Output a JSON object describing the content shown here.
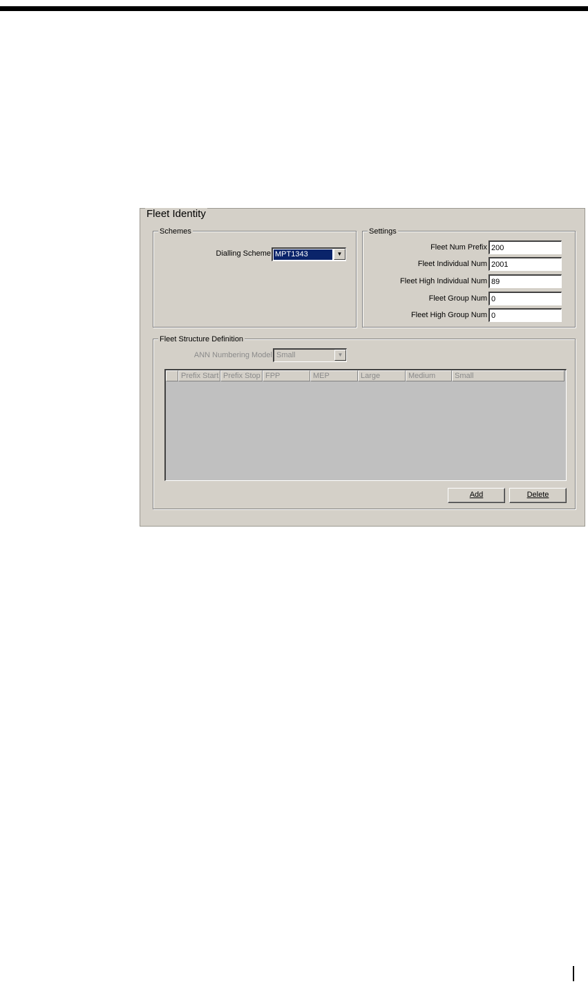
{
  "panel": {
    "title": "Fleet Identity"
  },
  "schemes": {
    "group_label": "Schemes",
    "dialling_scheme_label": "Dialling Scheme",
    "dialling_scheme_value": "MPT1343"
  },
  "settings": {
    "group_label": "Settings",
    "fields": [
      {
        "label": "Fleet Num Prefix",
        "value": "200"
      },
      {
        "label": "Fleet Individual Num",
        "value": "2001"
      },
      {
        "label": "Fleet High Individual Num",
        "value": "89"
      },
      {
        "label": "Fleet Group Num",
        "value": "0"
      },
      {
        "label": "Fleet High Group Num",
        "value": "0"
      }
    ]
  },
  "structure": {
    "group_label": "Fleet Structure Definition",
    "ann_model_label": "ANN Numbering Model",
    "ann_model_value": "Small",
    "columns": [
      "",
      "Prefix Start",
      "Prefix Stop",
      "FPP",
      "MEP",
      "Large",
      "Medium",
      "Small"
    ],
    "add_label": "Add",
    "delete_label": "Delete"
  },
  "icons": {
    "dropdown": "chevron-down-icon"
  },
  "colors": {
    "dialog_bg": "#d4d0c8",
    "selection": "#0a246a",
    "grid_bg": "#c0c0c0"
  }
}
